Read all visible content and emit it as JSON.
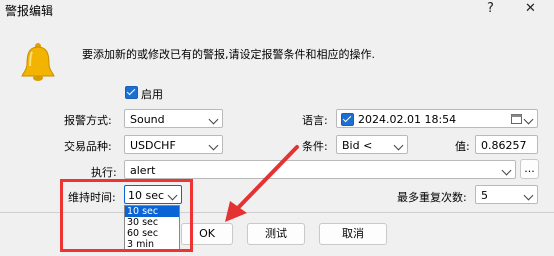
{
  "window": {
    "title": "警报编辑",
    "help_glyph": "?",
    "close_glyph": "✕"
  },
  "description": "要添加新的或修改已有的警报,请设定报警条件和相应的操作.",
  "enable": {
    "label": "启用",
    "checked": true
  },
  "action_type": {
    "label": "报警方式:",
    "value": "Sound"
  },
  "symbol": {
    "label": "交易品种:",
    "value": "USDCHF"
  },
  "execute": {
    "label": "执行:",
    "value": "alert",
    "browse_label": "..."
  },
  "language": {
    "label": "语言:",
    "value": "2024.02.01 18:54",
    "checked": true
  },
  "condition": {
    "label": "条件:",
    "value": "Bid <"
  },
  "value_field": {
    "label": "值:",
    "value": "0.86257"
  },
  "duration": {
    "label": "维持时间:",
    "value": "10 sec",
    "options": [
      "10 sec",
      "30 sec",
      "60 sec",
      "3 min"
    ],
    "selected_index": 0
  },
  "max_repeats": {
    "label": "最多重复次数:",
    "value": "5"
  },
  "buttons": {
    "ok": "OK",
    "test": "测试",
    "cancel": "取消"
  },
  "colors": {
    "accent": "#0a64d6",
    "highlight": "#e33333",
    "bell": "#f2b400"
  }
}
